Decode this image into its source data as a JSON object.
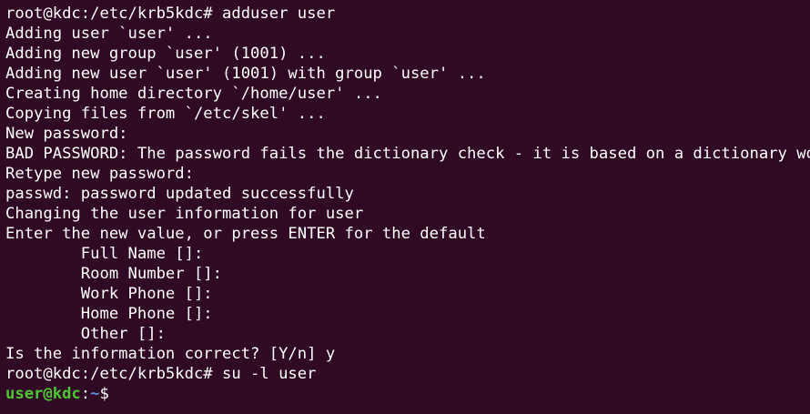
{
  "colors": {
    "background": "#300a24",
    "foreground": "#ffffff",
    "prompt_user": "#4ec736",
    "prompt_path": "#5c8fd6"
  },
  "lines": [
    "root@kdc:/etc/krb5kdc# adduser user",
    "Adding user `user' ...",
    "Adding new group `user' (1001) ...",
    "Adding new user `user' (1001) with group `user' ...",
    "Creating home directory `/home/user' ...",
    "Copying files from `/etc/skel' ...",
    "New password:",
    "BAD PASSWORD: The password fails the dictionary check - it is based on a dictionary word",
    "Retype new password:",
    "passwd: password updated successfully",
    "Changing the user information for user",
    "Enter the new value, or press ENTER for the default",
    "        Full Name []:",
    "        Room Number []:",
    "        Work Phone []:",
    "        Home Phone []:",
    "        Other []:",
    "Is the information correct? [Y/n] y",
    "root@kdc:/etc/krb5kdc# su -l user"
  ],
  "final_prompt": {
    "user_host": "user@kdc",
    "separator": ":",
    "path": "~",
    "symbol": "$"
  }
}
